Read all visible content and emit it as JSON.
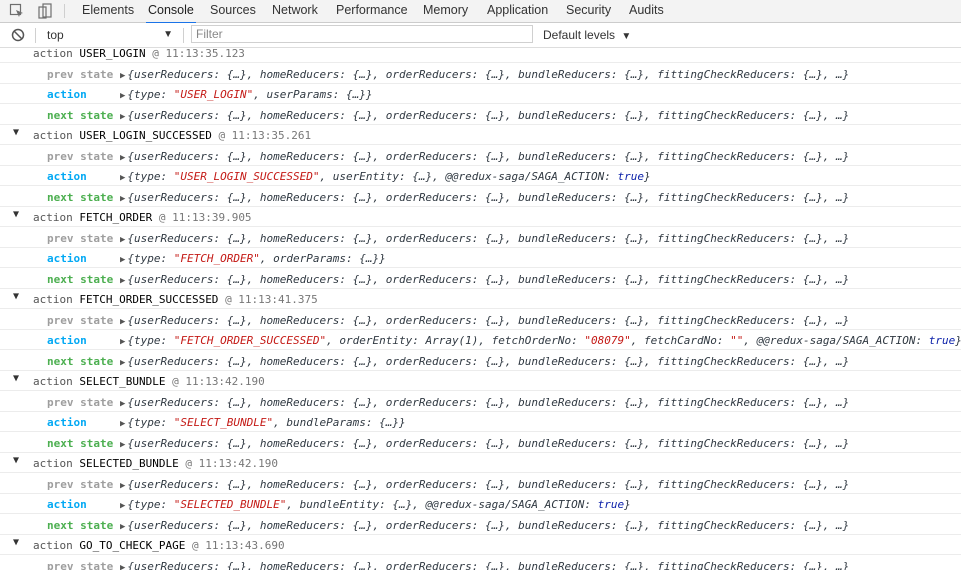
{
  "tabs": [
    "Elements",
    "Console",
    "Sources",
    "Network",
    "Performance",
    "Memory",
    "Application",
    "Security",
    "Audits"
  ],
  "active_tab": "Console",
  "toolbar": {
    "context": "top",
    "filter_placeholder": "Filter",
    "levels": "Default levels"
  },
  "labels": {
    "prev": "prev state",
    "action": "action",
    "next": "next state",
    "group_prefix": "action"
  },
  "state_summary": "{userReducers: {…}, homeReducers: {…}, orderReducers: {…}, bundleReducers: {…}, fittingCheckReducers: {…}, …}",
  "partial_top": {
    "name": "USER_LOGIN",
    "timestamp": "@ 11:13:35.123"
  },
  "groups": [
    {
      "name": "USER_LOGIN_SUCCESSED",
      "timestamp": "@ 11:13:35.261",
      "action": [
        {
          "t": "{type: "
        },
        {
          "t": "\"USER_LOGIN_SUCCESSED\"",
          "c": "str"
        },
        {
          "t": ", userEntity: {…}, @@redux-saga/SAGA_ACTION: "
        },
        {
          "t": "true",
          "c": "bool"
        },
        {
          "t": "}"
        }
      ]
    },
    {
      "name": "FETCH_ORDER",
      "timestamp": "@ 11:13:39.905",
      "action": [
        {
          "t": "{type: "
        },
        {
          "t": "\"FETCH_ORDER\"",
          "c": "str"
        },
        {
          "t": ", orderParams: {…}}"
        }
      ]
    },
    {
      "name": "FETCH_ORDER_SUCCESSED",
      "timestamp": "@ 11:13:41.375",
      "action": [
        {
          "t": "{type: "
        },
        {
          "t": "\"FETCH_ORDER_SUCCESSED\"",
          "c": "str"
        },
        {
          "t": ", orderEntity: Array(1), fetchOrderNo: "
        },
        {
          "t": "\"08079\"",
          "c": "str"
        },
        {
          "t": ", fetchCardNo: "
        },
        {
          "t": "\"\"",
          "c": "str"
        },
        {
          "t": ", @@redux-saga/SAGA_ACTION: "
        },
        {
          "t": "true",
          "c": "bool"
        },
        {
          "t": "}"
        }
      ]
    },
    {
      "name": "SELECT_BUNDLE",
      "timestamp": "@ 11:13:42.190",
      "action": [
        {
          "t": "{type: "
        },
        {
          "t": "\"SELECT_BUNDLE\"",
          "c": "str"
        },
        {
          "t": ", bundleParams: {…}}"
        }
      ]
    },
    {
      "name": "SELECTED_BUNDLE",
      "timestamp": "@ 11:13:42.190",
      "action": [
        {
          "t": "{type: "
        },
        {
          "t": "\"SELECTED_BUNDLE\"",
          "c": "str"
        },
        {
          "t": ", bundleEntity: {…}, @@redux-saga/SAGA_ACTION: "
        },
        {
          "t": "true",
          "c": "bool"
        },
        {
          "t": "}"
        }
      ]
    }
  ],
  "first_action": [
    {
      "t": "{type: "
    },
    {
      "t": "\"USER_LOGIN\"",
      "c": "str"
    },
    {
      "t": ", userParams: {…}}"
    }
  ],
  "last_group": {
    "name": "GO_TO_CHECK_PAGE",
    "timestamp": "@ 11:13:43.690"
  },
  "colors": {
    "prev": "#9e9e9e",
    "action": "#03a9f4",
    "next": "#4caf50",
    "string": "#c41a16",
    "boolean": "#0d22aa",
    "tab_active_underline": "#1a73e8"
  }
}
